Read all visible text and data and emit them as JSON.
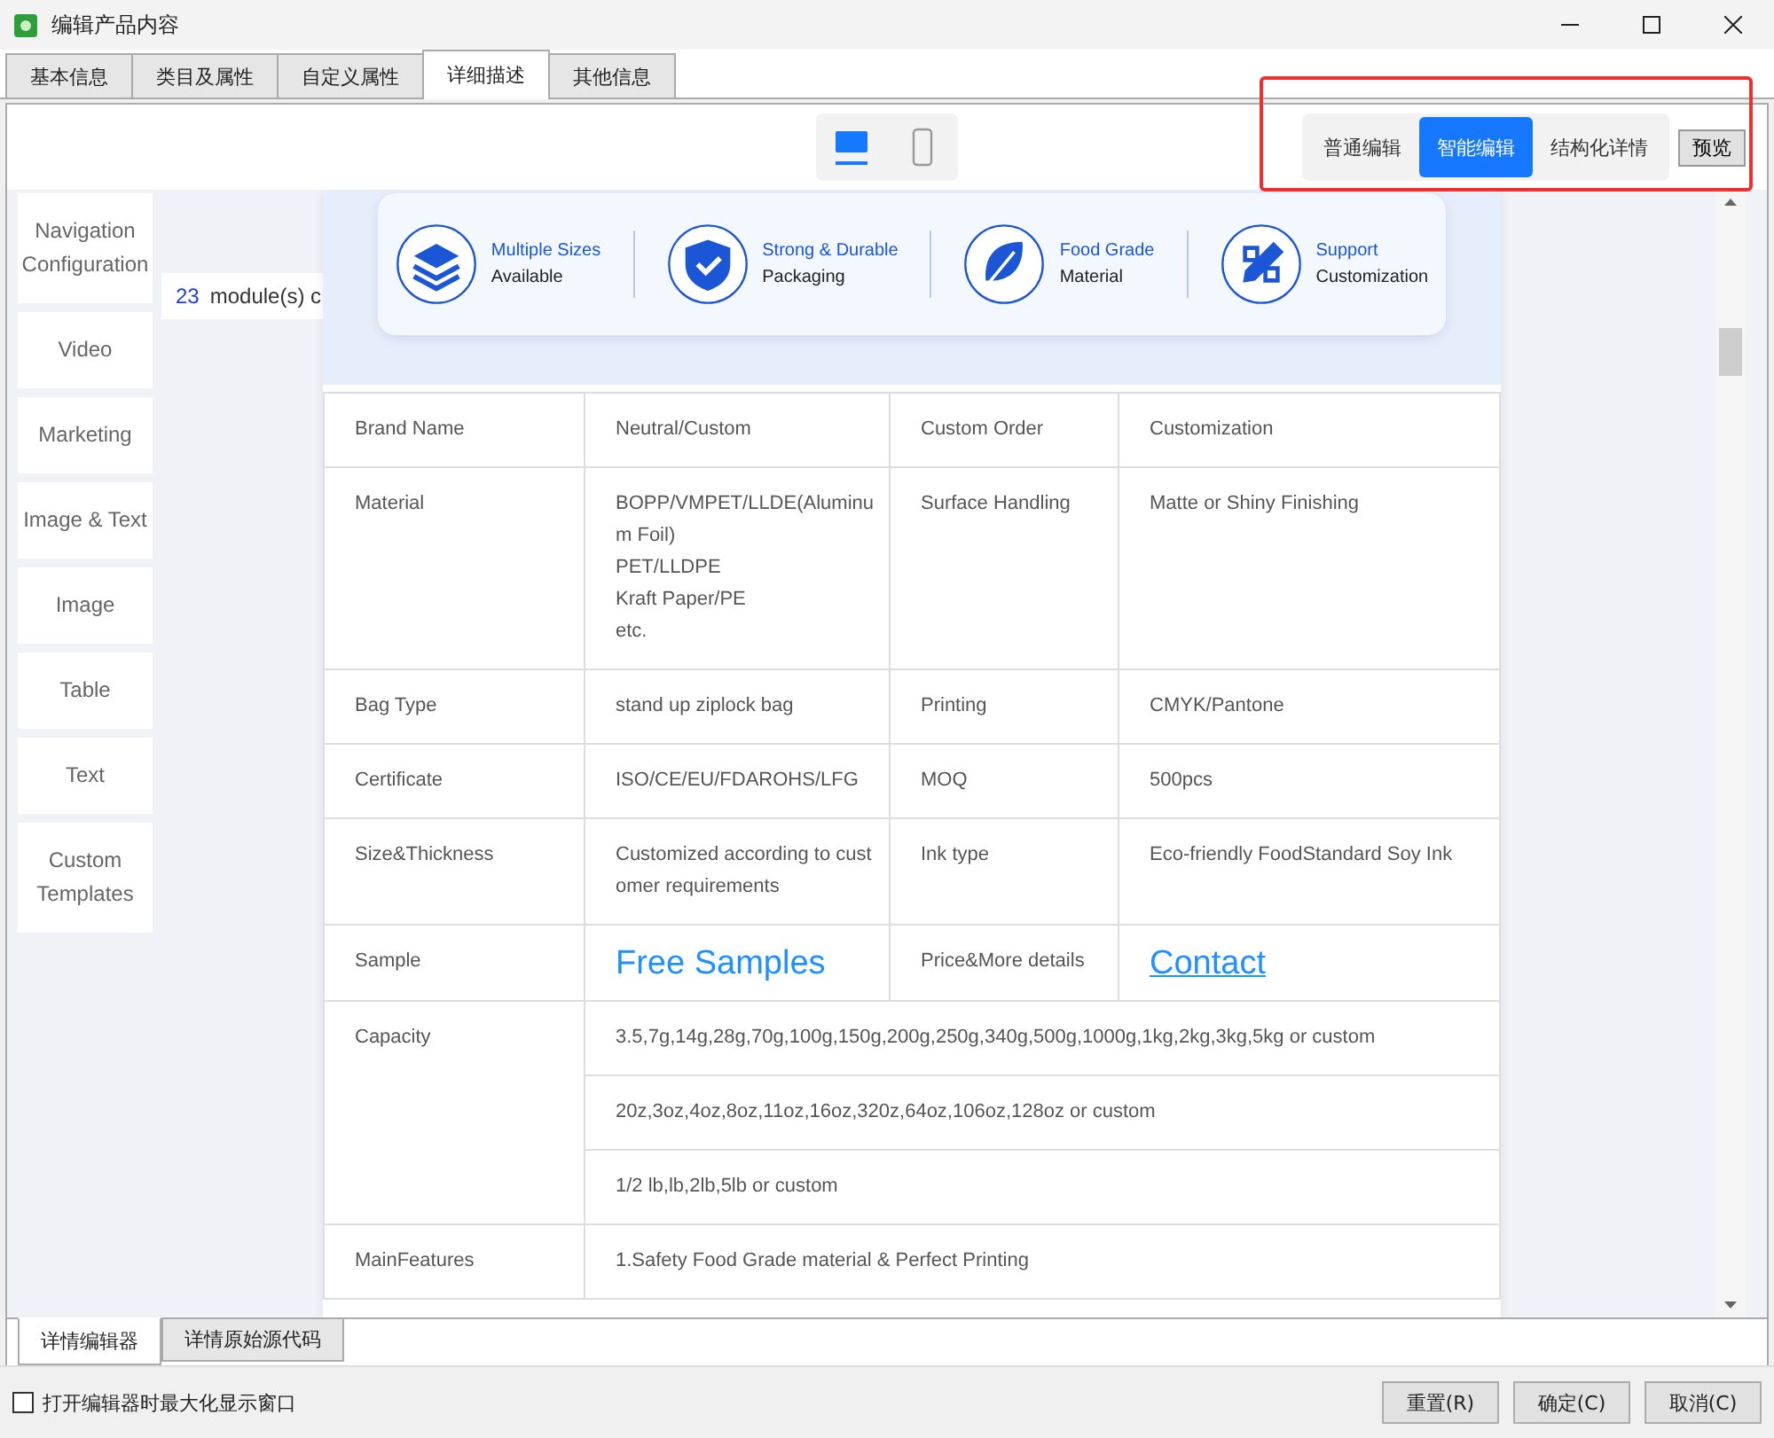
{
  "window": {
    "title": "编辑产品内容"
  },
  "tabs": [
    {
      "label": "基本信息",
      "selected": false
    },
    {
      "label": "类目及属性",
      "selected": false
    },
    {
      "label": "自定义属性",
      "selected": false
    },
    {
      "label": "详细描述",
      "selected": true
    },
    {
      "label": "其他信息",
      "selected": false
    }
  ],
  "device_toggle": [
    {
      "kind": "desktop",
      "selected": true
    },
    {
      "kind": "mobile",
      "selected": false
    }
  ],
  "edit_modes": [
    {
      "label": "普通编辑",
      "selected": false
    },
    {
      "label": "智能编辑",
      "selected": true
    },
    {
      "label": "结构化详情",
      "selected": false
    }
  ],
  "preview_button": "预览",
  "module_palette": [
    "Navigation Configuration",
    "Video",
    "Marketing",
    "Image & Text",
    "Image",
    "Table",
    "Text",
    "Custom Templates"
  ],
  "module_count": {
    "number": "23",
    "text": "module(s) c"
  },
  "feature_banner": [
    {
      "kind": "layers",
      "title": "Multiple Sizes",
      "subtitle": "Available"
    },
    {
      "kind": "shield",
      "title": "Strong & Durable",
      "subtitle": "Packaging"
    },
    {
      "kind": "leaf",
      "title": "Food Grade",
      "subtitle": "Material"
    },
    {
      "kind": "tools",
      "title": "Support",
      "subtitle": "Customization"
    }
  ],
  "spec_table": [
    {
      "label": "Brand Name",
      "cells": [
        {
          "kind": "text",
          "text": "Neutral/Custom"
        },
        {
          "kind": "text",
          "text": "Custom Order"
        },
        {
          "kind": "text",
          "text": "Customization"
        }
      ]
    },
    {
      "label": "Material",
      "cells": [
        {
          "kind": "text",
          "text": "BOPP/VMPET/LLDE(Aluminum Foil)\nPET/LLDPE\nKraft Paper/PE\netc."
        },
        {
          "kind": "text",
          "text": "Surface Handling"
        },
        {
          "kind": "text",
          "text": "Matte or Shiny Finishing"
        }
      ]
    },
    {
      "label": "Bag Type",
      "cells": [
        {
          "kind": "text",
          "text": "stand up ziplock bag"
        },
        {
          "kind": "text",
          "text": "Printing"
        },
        {
          "kind": "text",
          "text": "CMYK/Pantone"
        }
      ]
    },
    {
      "label": "Certificate",
      "cells": [
        {
          "kind": "text",
          "text": "ISO/CE/EU/FDAROHS/LFG"
        },
        {
          "kind": "text",
          "text": "MOQ"
        },
        {
          "kind": "text",
          "text": "500pcs"
        }
      ]
    },
    {
      "label": "Size&Thickness",
      "cells": [
        {
          "kind": "text",
          "text": "Customized according to customer requirements"
        },
        {
          "kind": "text",
          "text": "Ink type"
        },
        {
          "kind": "text",
          "text": "Eco-friendly FoodStandard Soy Ink"
        }
      ]
    },
    {
      "label": "Sample",
      "cells": [
        {
          "kind": "highlight",
          "text": "Free Samples"
        },
        {
          "kind": "text",
          "text": "Price&More details"
        },
        {
          "kind": "link",
          "text": "Contact"
        }
      ]
    },
    {
      "label": "Capacity",
      "lines": [
        "3.5,7g,14g,28g,70g,100g,150g,200g,250g,340g,500g,1000g,1kg,2kg,3kg,5kg or custom",
        "20z,3oz,4oz,8oz,11oz,16oz,320z,64oz,106oz,128oz or custom",
        "1/2 lb,lb,2lb,5lb or custom"
      ]
    },
    {
      "label": "MainFeatures",
      "lines": [
        "1.Safety Food Grade material & Perfect Printing"
      ]
    }
  ],
  "bottom_tabs": [
    {
      "label": "详情编辑器",
      "selected": true
    },
    {
      "label": "详情原始源代码",
      "selected": false
    }
  ],
  "maximize_option": {
    "label": "打开编辑器时最大化显示窗口",
    "checked": false
  },
  "buttons": [
    "重置(R)",
    "确定(C)",
    "取消(C)"
  ]
}
